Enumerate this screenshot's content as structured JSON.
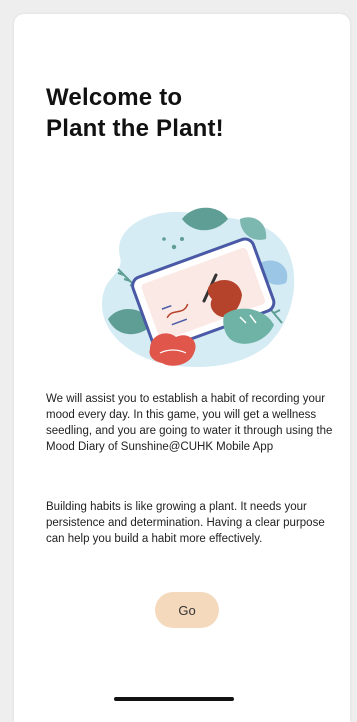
{
  "welcome": {
    "title_line1": "Welcome to",
    "title_line2": "Plant the Plant!",
    "paragraph1": "We will assist you to establish a habit of recording your mood every day. In this game, you will get a wellness seedling, and you are going to water it through using the Mood Diary of Sunshine@CUHK Mobile App",
    "paragraph2": "Building habits is like growing a plant. It needs your persistence and determination. Having a clear purpose can help you build a habit more effectively.",
    "go_label": "Go"
  },
  "illustration": {
    "icon": "writing-on-tablet-illustration"
  },
  "colors": {
    "button_bg": "#f5d9bd",
    "blob": "#d5ecf4",
    "leaf_green": "#5f9e95",
    "tablet_outline": "#4a59a6",
    "hand": "#b5432b",
    "red_leaf": "#e0564b"
  }
}
